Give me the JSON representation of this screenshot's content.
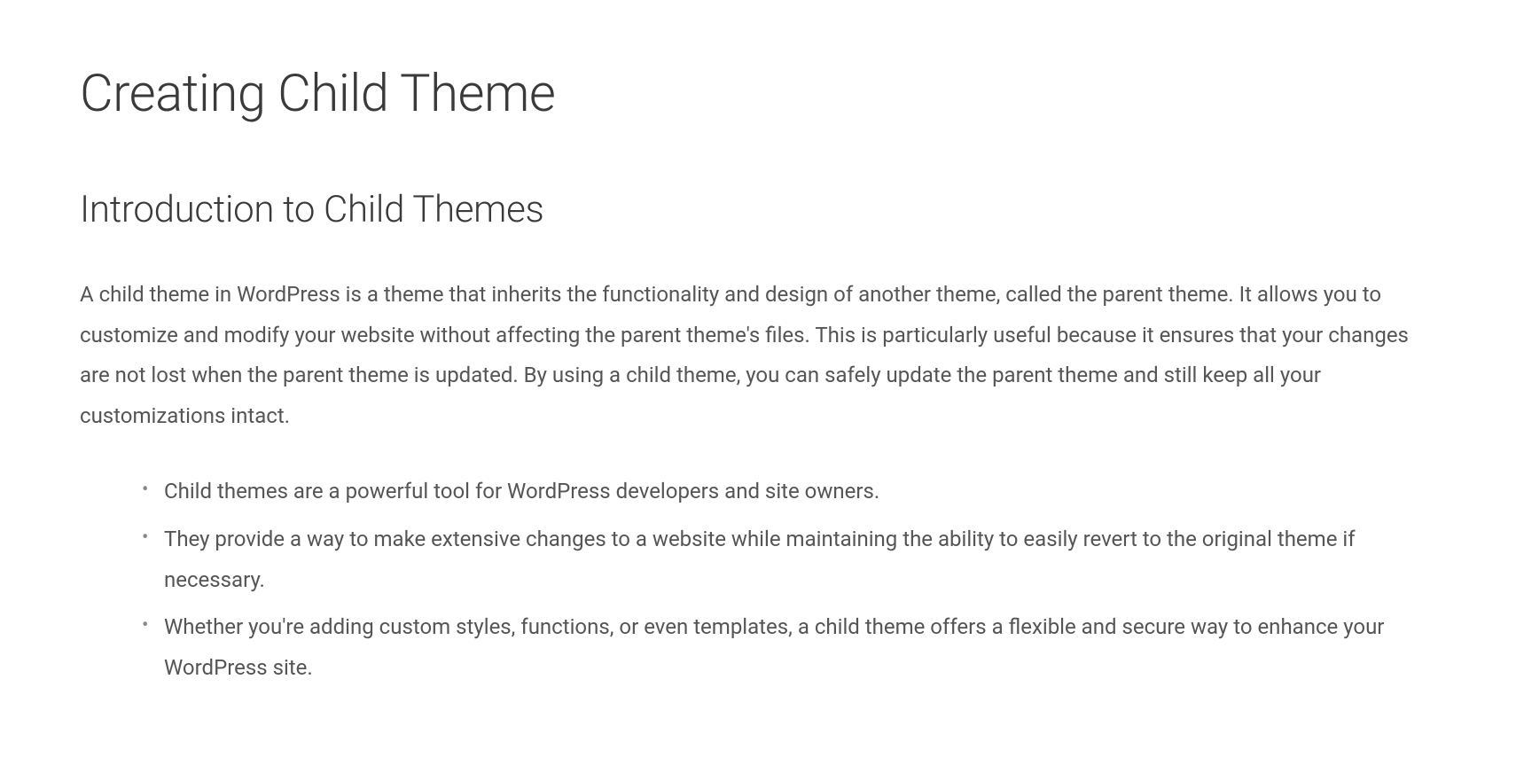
{
  "heading": {
    "title": "Creating Child Theme",
    "subtitle": "Introduction to Child Themes"
  },
  "content": {
    "paragraph": "A child theme in WordPress is a theme that inherits the functionality and design of another theme, called the parent theme. It allows you to customize and modify your website without affecting the parent theme's files. This is particularly useful because it ensures that your changes are not lost when the parent theme is updated. By using a child theme, you can safely update the parent theme and still keep all your customizations intact.",
    "bullets": [
      "Child themes are a powerful tool for WordPress developers and site owners.",
      "They provide a way to make extensive changes to a website while maintaining the ability to easily revert to the original theme if necessary.",
      "Whether you're adding custom styles, functions, or even templates, a child theme offers a flexible and secure way to enhance your WordPress site."
    ]
  }
}
